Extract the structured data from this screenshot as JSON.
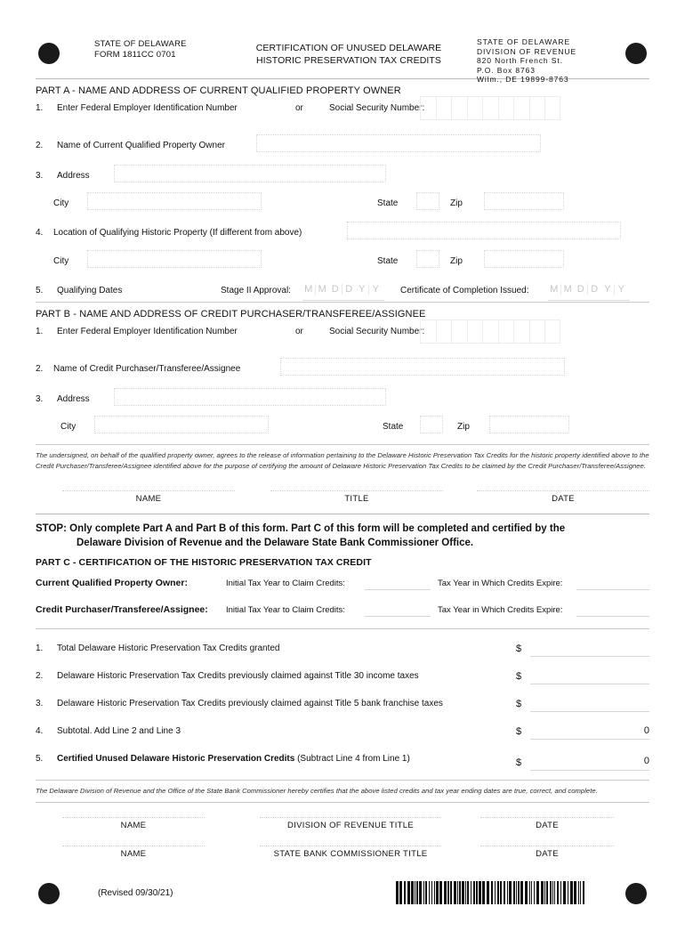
{
  "header": {
    "left_line1": "STATE OF DELAWARE",
    "left_line2": "FORM 1811CC 0701",
    "title_line1": "CERTIFICATION OF UNUSED DELAWARE",
    "title_line2": "HISTORIC PRESERVATION TAX CREDITS",
    "right_line1": "STATE OF DELAWARE",
    "right_line2": "DIVISION OF REVENUE",
    "right_line3": "820 North French St.",
    "right_line4": "P.O. Box 8763",
    "right_line5": "Wilm., DE  19899-8763"
  },
  "part_a": {
    "title": "PART A - NAME AND ADDRESS OF CURRENT QUALIFIED PROPERTY OWNER",
    "line1_num": "1.",
    "line1_label": "Enter Federal Employer Identification Number",
    "line1_or": "or",
    "line1_ssn_label": "Social Security Number:",
    "ssn_cells": 9,
    "line2_num": "2.",
    "line2_label": "Name of Current Qualified Property Owner",
    "line2_value": "",
    "line3_num": "3.",
    "line3_label": "Address",
    "line3_value": "",
    "city_label": "City",
    "city_value": "",
    "state_label": "State",
    "state_value": "",
    "zip_label": "Zip",
    "zip_value": "",
    "line4_num": "4.",
    "line4_label": "Location of Qualifying Historic Property (If different from above)",
    "line4_value": "",
    "city2_label": "City",
    "city2_value": "",
    "state2_label": "State",
    "state2_value": "",
    "zip2_label": "Zip",
    "zip2_value": "",
    "line5_num": "5.",
    "line5_label": "Qualifying Dates",
    "stage_label": "Stage II Approval:",
    "completion_label": "Certificate of Completion Issued:",
    "date_placeholder": [
      "M",
      "M",
      "D",
      "D",
      "Y",
      "Y"
    ]
  },
  "part_b": {
    "title": "PART B - NAME AND ADDRESS OF CREDIT PURCHASER/TRANSFEREE/ASSIGNEE",
    "line1_num": "1.",
    "line1_label": "Enter Federal Employer Identification Number",
    "line1_or": "or",
    "line1_ssn_label": "Social Security Number:",
    "line2_num": "2.",
    "line2_label": "Name of Credit Purchaser/Transferee/Assignee",
    "line2_value": "",
    "line3_num": "3.",
    "line3_label": "Address",
    "line3_value": "",
    "city_label": "City",
    "city_value": "",
    "state_label": "State",
    "state_value": "",
    "zip_label": "Zip",
    "zip_value": "",
    "undersigned_text": "The undersigned, on behalf of the qualified property owner, agrees to the release of information pertaining to the Delaware Historic Preservation Tax Credits for the historic property identified above to the Credit Purchaser/Transferee/Assignee identified above for the purpose of certifying the amount of Delaware Historic Preservation Tax Credits to be claimed by the Credit Purchaser/Transferee/Assignee.",
    "sig_name": "NAME",
    "sig_title": "TITLE",
    "sig_date": "DATE"
  },
  "stop_notice": {
    "line1": "STOP:  Only complete Part A and Part B of this form. Part C of this form will be completed and certified by the",
    "line2": "Delaware Division of Revenue and the Delaware State Bank Commissioner Office."
  },
  "part_c": {
    "title": "PART C - CERTIFICATION OF THE HISTORIC PRESERVATION TAX CREDIT",
    "owner_label": "Current Qualified Property Owner:",
    "owner_initial_label": "Initial Tax Year to Claim Credits:",
    "owner_initial_value": "",
    "owner_expire_label": "Tax Year in Which Credits Expire:",
    "owner_expire_value": "",
    "purchaser_label": "Credit Purchaser/Transferee/Assignee:",
    "purchaser_initial_label": "Initial Tax Year to Claim Credits:",
    "purchaser_initial_value": "",
    "purchaser_expire_label": "Tax Year in Which Credits Expire:",
    "purchaser_expire_value": "",
    "currency_symbol": "$",
    "lines": [
      {
        "num": "1.",
        "text": "Total Delaware Historic Preservation Tax Credits granted",
        "bold": "",
        "paren": "",
        "value": ""
      },
      {
        "num": "2.",
        "text": "Delaware Historic Preservation Tax Credits previously claimed against Title 30 income taxes",
        "bold": "",
        "paren": "",
        "value": ""
      },
      {
        "num": "3.",
        "text": "Delaware Historic Preservation Tax Credits previously claimed against Title 5 bank franchise taxes",
        "bold": "",
        "paren": "",
        "value": ""
      },
      {
        "num": "4.",
        "text": "Subtotal. Add Line 2 and Line 3",
        "bold": "",
        "paren": "",
        "value": "0"
      },
      {
        "num": "5.",
        "text": "",
        "bold": "Certified Unused Delaware Historic Preservation Credits",
        "paren": "(Subtract Line 4 from Line 1)",
        "value": "0"
      }
    ],
    "certify_text": "The Delaware Division of Revenue and the Office of the State Bank Commissioner hereby certifies that the above listed credits and tax year ending dates are true, correct, and complete.",
    "sig1_name": "NAME",
    "sig1_title": "DIVISION OF REVENUE TITLE",
    "sig1_date": "DATE",
    "sig2_name": "NAME",
    "sig2_title": "STATE BANK COMMISSIONER TITLE",
    "sig2_date": "DATE"
  },
  "footer": {
    "revised": "(Revised 09/30/21)"
  }
}
